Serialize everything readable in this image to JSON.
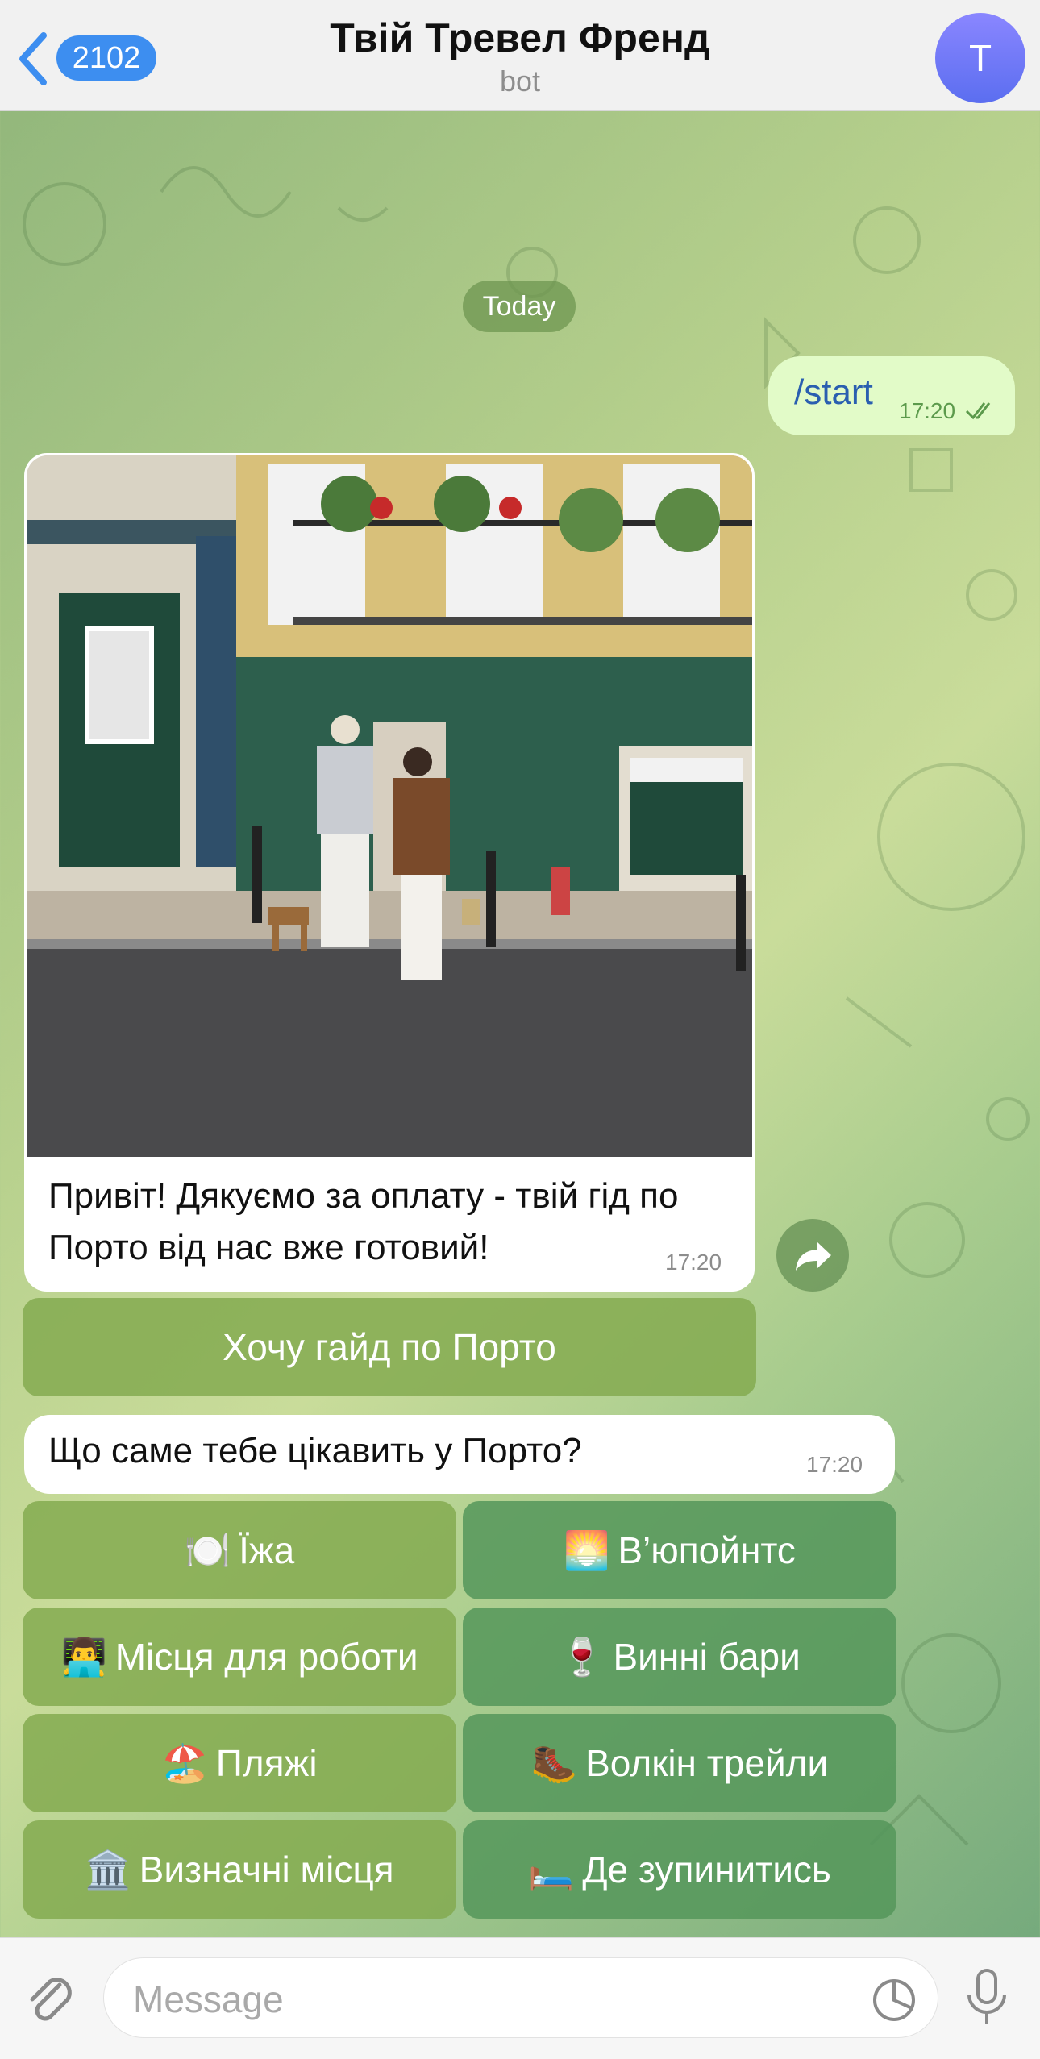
{
  "header": {
    "back_count": "2102",
    "title": "Твій Тревел Френд",
    "subtitle": "bot",
    "avatar_letter": "T"
  },
  "chat": {
    "date_label": "Today",
    "outgoing": {
      "text": "/start",
      "time": "17:20"
    },
    "photo_message": {
      "caption": "Привіт! Дякуємо за оплату - твій гід по Порто від нас вже готовий!",
      "time": "17:20"
    },
    "inline_button": "Хочу гайд по Порто",
    "question": {
      "text": "Що саме тебе цікавить у Порто?",
      "time": "17:20"
    },
    "keyboard": [
      {
        "emoji": "🍽️",
        "label": "Їжа"
      },
      {
        "emoji": "🌅",
        "label": "В’юпойнтс"
      },
      {
        "emoji": "👨‍💻",
        "label": "Місця для роботи"
      },
      {
        "emoji": "🍷",
        "label": "Винні бари"
      },
      {
        "emoji": "🏖️",
        "label": "Пляжі"
      },
      {
        "emoji": "🥾",
        "label": "Волкін трейли"
      },
      {
        "emoji": "🏛️",
        "label": "Визначні місця"
      },
      {
        "emoji": "🛏️",
        "label": "Де зупинитись"
      }
    ]
  },
  "composer": {
    "placeholder": "Message"
  },
  "colors": {
    "accent": "#3d8ef0",
    "outgoing_bubble": "#e2fbc8",
    "header_bg": "#f1f1f1"
  }
}
